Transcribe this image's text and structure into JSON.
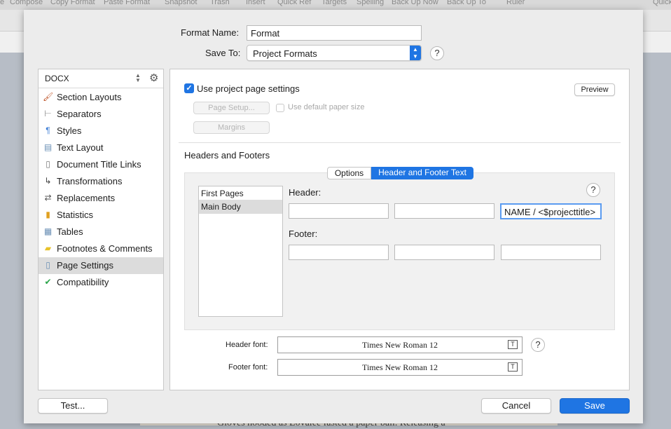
{
  "background_toolbar": {
    "items": [
      "e",
      "Compose",
      "Copy Format",
      "Paste Format",
      "Snapshot",
      "Trash",
      "Insert",
      "Quick Ref",
      "Targets",
      "Spelling",
      "Back Up Now",
      "Back Up To",
      "Ruler",
      "Quick"
    ]
  },
  "background_doc_text": "Gloves hooded as Lovalee fasted a paper ball. Releasing a",
  "format": {
    "name_label": "Format Name:",
    "name_value": "Format",
    "save_to_label": "Save To:",
    "save_to_value": "Project Formats"
  },
  "sidebar": {
    "popup_value": "DOCX",
    "items": [
      {
        "label": "Section Layouts",
        "icon": "brush-icon"
      },
      {
        "label": "Separators",
        "icon": "separator-icon"
      },
      {
        "label": "Styles",
        "icon": "styles-icon"
      },
      {
        "label": "Text Layout",
        "icon": "text-layout-icon"
      },
      {
        "label": "Document Title Links",
        "icon": "document-icon"
      },
      {
        "label": "Transformations",
        "icon": "transform-icon"
      },
      {
        "label": "Replacements",
        "icon": "replace-icon"
      },
      {
        "label": "Statistics",
        "icon": "bar-chart-icon"
      },
      {
        "label": "Tables",
        "icon": "table-icon"
      },
      {
        "label": "Footnotes & Comments",
        "icon": "comment-icon"
      },
      {
        "label": "Page Settings",
        "icon": "page-icon"
      },
      {
        "label": "Compatibility",
        "icon": "compatibility-icon"
      }
    ],
    "selected": "Page Settings"
  },
  "page_settings": {
    "use_project_label": "Use project page settings",
    "use_project_checked": true,
    "preview_label": "Preview",
    "page_setup_label": "Page Setup...",
    "default_paper_label": "Use default paper size",
    "margins_label": "Margins",
    "section_title": "Headers and Footers",
    "tabs": [
      "Options",
      "Header and Footer Text"
    ],
    "active_tab": "Header and Footer Text",
    "pages": [
      "First Pages",
      "Main Body"
    ],
    "selected_page": "Main Body",
    "header_label": "Header:",
    "footer_label": "Footer:",
    "header_fields": [
      "",
      "",
      "NAME / <$projecttitle>"
    ],
    "footer_fields": [
      "",
      "",
      ""
    ],
    "help_symbol": "?",
    "header_font_label": "Header font:",
    "header_font_value": "Times New Roman 12",
    "footer_font_label": "Footer font:",
    "footer_font_value": "Times New Roman 12"
  },
  "footer_buttons": {
    "test_label": "Test...",
    "cancel_label": "Cancel",
    "save_label": "Save"
  },
  "colors": {
    "accent": "#1f75e3",
    "selection": "#dcdcdc"
  }
}
